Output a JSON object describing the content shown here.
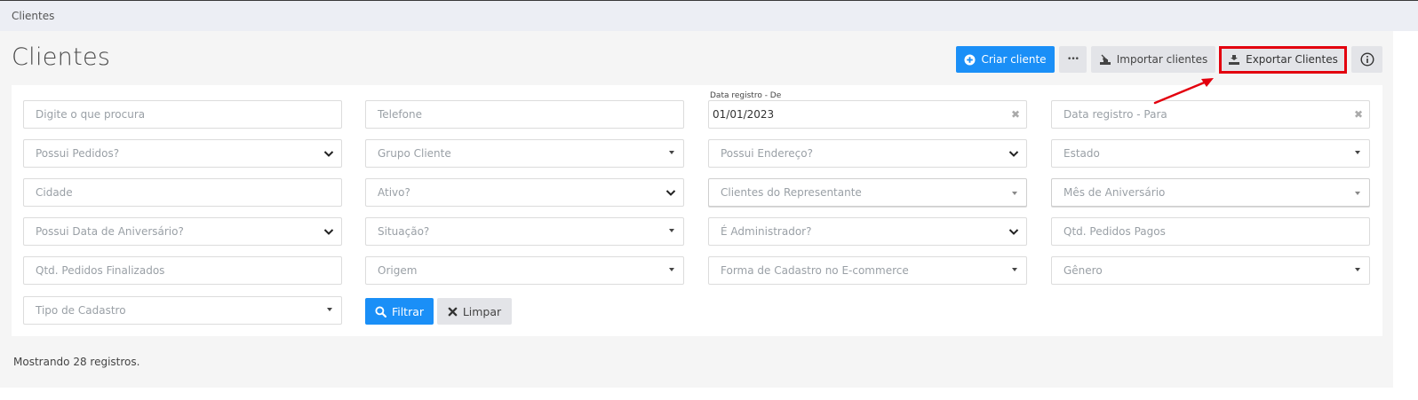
{
  "breadcrumb": "Clientes",
  "page_title": "Clientes",
  "header_buttons": {
    "create": "Criar cliente",
    "more": "•••",
    "import": "Importar clientes",
    "export": "Exportar Clientes"
  },
  "filters": {
    "search_placeholder": "Digite o que procura",
    "telefone_placeholder": "Telefone",
    "data_de_label": "Data registro - De",
    "data_de_value": "01/01/2023",
    "data_para_placeholder": "Data registro - Para",
    "possui_pedidos": "Possui Pedidos?",
    "grupo_cliente": "Grupo Cliente",
    "possui_endereco": "Possui Endereço?",
    "estado": "Estado",
    "cidade": "Cidade",
    "ativo": "Ativo?",
    "clientes_representante": "Clientes do Representante",
    "mes_aniversario": "Mês de Aniversário",
    "possui_data_aniversario": "Possui Data de Aniversário?",
    "situacao": "Situação?",
    "administrador": "É Administrador?",
    "qtd_pedidos_pagos": "Qtd. Pedidos Pagos",
    "qtd_pedidos_finalizados": "Qtd. Pedidos Finalizados",
    "origem": "Origem",
    "forma_cadastro": "Forma de Cadastro no E-commerce",
    "genero": "Gênero",
    "tipo_cadastro": "Tipo de Cadastro"
  },
  "actions": {
    "filtrar": "Filtrar",
    "limpar": "Limpar"
  },
  "status_text": "Mostrando 28 registros.",
  "colors": {
    "primary": "#1a8ff7",
    "highlight": "#e3000e"
  }
}
